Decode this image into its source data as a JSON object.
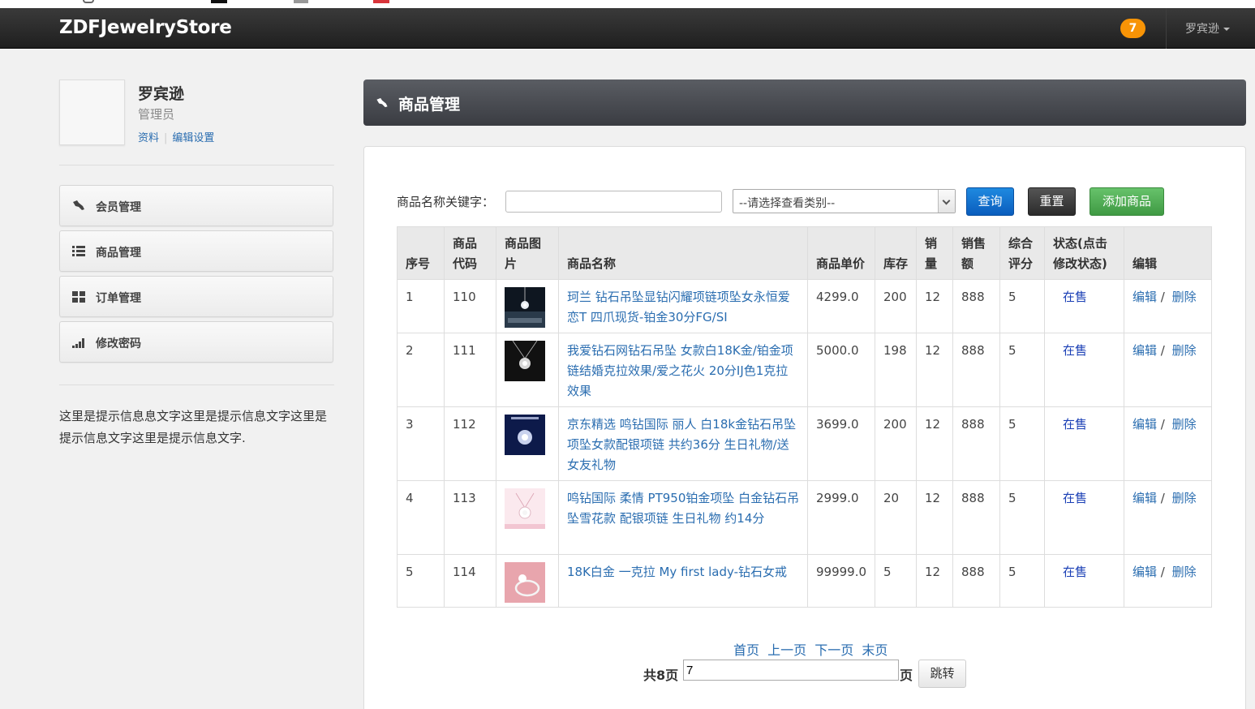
{
  "app": {
    "brand": "ZDFJewelryStore",
    "notification_count": "7",
    "user_menu": "罗宾逊"
  },
  "profile": {
    "name": "罗宾逊",
    "role": "管理员",
    "link_profile": "资料",
    "link_settings": "编辑设置"
  },
  "sidebar": {
    "items": [
      {
        "label": "会员管理",
        "icon": "wrench-icon"
      },
      {
        "label": "商品管理",
        "icon": "list-icon"
      },
      {
        "label": "订单管理",
        "icon": "grid-icon"
      },
      {
        "label": "修改密码",
        "icon": "signal-icon"
      }
    ],
    "tip": "这里是提示信息息文字这里是提示信息文字这里是提示信息文字这里是提示信息文字."
  },
  "main": {
    "title": "商品管理",
    "search": {
      "label": "商品名称关键字：",
      "value": "",
      "category_selected": "--请选择查看类别--",
      "query_button": "查询",
      "reset_button": "重置",
      "add_button": "添加商品"
    },
    "table": {
      "headers": [
        "序号",
        "商品代码",
        "商品图片",
        "商品名称",
        "商品单价",
        "库存",
        "销量",
        "销售额",
        "综合评分",
        "状态(点击修改状态)",
        "编辑"
      ],
      "rows": [
        {
          "no": "1",
          "code": "110",
          "image": "pendant-photo",
          "name": "珂兰 钻石吊坠显钻闪耀项链项坠女永恒爱恋T 四爪现货-铂金30分FG/SI",
          "price": "4299.0",
          "stock": "200",
          "sales": "12",
          "revenue": "888",
          "rating": "5",
          "status": "在售",
          "edit": "编辑",
          "delete": "删除"
        },
        {
          "no": "2",
          "code": "111",
          "image": "pendant-photo",
          "name": "我爱钻石网钻石吊坠 女款白18K金/铂金项链结婚克拉效果/爱之花火 20分IJ色1克拉效果",
          "price": "5000.0",
          "stock": "198",
          "sales": "12",
          "revenue": "888",
          "rating": "5",
          "status": "在售",
          "edit": "编辑",
          "delete": "删除"
        },
        {
          "no": "3",
          "code": "112",
          "image": "pendant-photo",
          "name": "京东精选 鸣钻国际 丽人 白18k金钻石吊坠项坠女款配银项链 共约36分 生日礼物/送女友礼物",
          "price": "3699.0",
          "stock": "200",
          "sales": "12",
          "revenue": "888",
          "rating": "5",
          "status": "在售",
          "edit": "编辑",
          "delete": "删除"
        },
        {
          "no": "4",
          "code": "113",
          "image": "pendant-photo",
          "name": "鸣钻国际 柔情 PT950铂金项坠 白金钻石吊坠雪花款 配银项链 生日礼物 约14分",
          "price": "2999.0",
          "stock": "20",
          "sales": "12",
          "revenue": "888",
          "rating": "5",
          "status": "在售",
          "edit": "编辑",
          "delete": "删除"
        },
        {
          "no": "5",
          "code": "114",
          "image": "ring-photo",
          "name": "18K白金 一克拉 My first lady-钻石女戒",
          "price": "99999.0",
          "stock": "5",
          "sales": "12",
          "revenue": "888",
          "rating": "5",
          "status": "在售",
          "edit": "编辑",
          "delete": "删除"
        }
      ]
    },
    "pager": {
      "first": "首页",
      "prev": "上一页",
      "next": "下一页",
      "last": "末页",
      "total": "共8页",
      "page_value": "7",
      "suffix": "页",
      "jump_button": "跳转"
    }
  },
  "colors": {
    "navbar": "#2b2b2b",
    "badge": "#f89406",
    "query": "#0a5dbd",
    "reset": "#2b2b2b",
    "add": "#4ca750",
    "link": "#2a6db0"
  }
}
